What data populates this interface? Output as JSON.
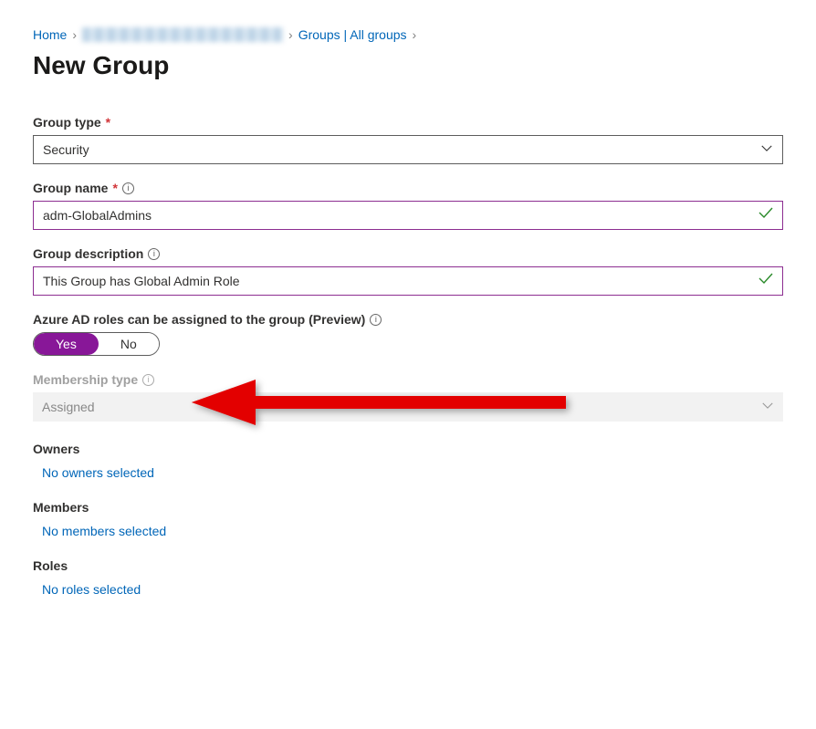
{
  "breadcrumb": {
    "home": "Home",
    "groups": "Groups | All groups"
  },
  "page": {
    "title": "New Group"
  },
  "groupType": {
    "label": "Group type",
    "value": "Security"
  },
  "groupName": {
    "label": "Group name",
    "value": "adm-GlobalAdmins"
  },
  "groupDesc": {
    "label": "Group description",
    "value": "This Group has Global Admin Role"
  },
  "rolesAssign": {
    "label": "Azure AD roles can be assigned to the group (Preview)",
    "yes": "Yes",
    "no": "No"
  },
  "membershipType": {
    "label": "Membership type",
    "value": "Assigned"
  },
  "owners": {
    "label": "Owners",
    "link": "No owners selected"
  },
  "members": {
    "label": "Members",
    "link": "No members selected"
  },
  "roles": {
    "label": "Roles",
    "link": "No roles selected"
  }
}
